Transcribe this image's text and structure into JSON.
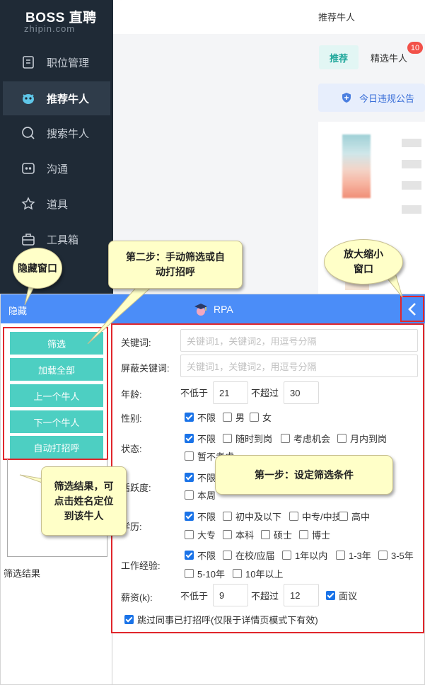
{
  "sidebar": {
    "logo": "BOSS 直聘",
    "logo_sub": "zhipin.com",
    "items": [
      {
        "label": "职位管理",
        "icon": "document-icon"
      },
      {
        "label": "推荐牛人",
        "icon": "mascot-icon"
      },
      {
        "label": "搜索牛人",
        "icon": "search-icon"
      },
      {
        "label": "沟通",
        "icon": "chat-icon"
      },
      {
        "label": "道具",
        "icon": "star-icon"
      },
      {
        "label": "工具箱",
        "icon": "briefcase-icon"
      }
    ]
  },
  "main": {
    "title": "推荐牛人",
    "tab_recommend": "推荐",
    "tab_selected": "精选牛人",
    "badge_count": "10",
    "notice": "今日违规公告"
  },
  "panel": {
    "hide": "隐藏",
    "title": "RPA",
    "toggle_icon": "chevron-left-icon",
    "buttons": {
      "filter": "筛选",
      "load_all": "加载全部",
      "prev": "上一个牛人",
      "next": "下一个牛人",
      "auto_greet": "自动打招呼"
    },
    "result_label": "筛选结果"
  },
  "form": {
    "keywords_label": "关键词:",
    "keywords_placeholder": "关键词1，关键词2，用逗号分隔",
    "block_label": "屏蔽关键词:",
    "block_placeholder": "关键词1，关键词2，用逗号分隔",
    "age_label": "年龄:",
    "min_text": "不低于",
    "max_text": "不超过",
    "age_min": "21",
    "age_max": "30",
    "gender_label": "性别:",
    "gender": [
      {
        "label": "不限",
        "checked": true
      },
      {
        "label": "男",
        "checked": false
      },
      {
        "label": "女",
        "checked": false
      }
    ],
    "status_label": "状态:",
    "status": [
      {
        "label": "不限",
        "checked": true
      },
      {
        "label": "随时到岗",
        "checked": false
      },
      {
        "label": "考虑机会",
        "checked": false
      },
      {
        "label": "月内到岗",
        "checked": false
      },
      {
        "label": "暂不考虑",
        "checked": false
      }
    ],
    "activity_label": "活跃度:",
    "activity": [
      {
        "label": "不限",
        "checked": true
      },
      {
        "label": "本周",
        "checked": false
      }
    ],
    "edu_label": "学历:",
    "edu": [
      {
        "label": "不限",
        "checked": true
      },
      {
        "label": "初中及以下",
        "checked": false
      },
      {
        "label": "中专/中技",
        "checked": false
      },
      {
        "label": "高中",
        "checked": false
      },
      {
        "label": "大专",
        "checked": false
      },
      {
        "label": "本科",
        "checked": false
      },
      {
        "label": "硕士",
        "checked": false
      },
      {
        "label": "博士",
        "checked": false
      }
    ],
    "exp_label": "工作经验:",
    "exp": [
      {
        "label": "不限",
        "checked": true
      },
      {
        "label": "在校/应届",
        "checked": false
      },
      {
        "label": "1年以内",
        "checked": false
      },
      {
        "label": "1-3年",
        "checked": false
      },
      {
        "label": "3-5年",
        "checked": false
      },
      {
        "label": "5-10年",
        "checked": false
      },
      {
        "label": "10年以上",
        "checked": false
      }
    ],
    "salary_label": "薪资(k):",
    "salary_min": "9",
    "salary_max": "12",
    "negotiable": {
      "label": "面议",
      "checked": true
    },
    "skip": {
      "label": "跳过同事已打招呼(仅限于详情页模式下有效)",
      "checked": true
    }
  },
  "callouts": {
    "hide_window": "隐藏窗口",
    "step2": "第二步：手动筛选或自动打招呼",
    "zoom": "放大缩小窗口",
    "step1": "第一步：设定筛选条件",
    "result_tip": "筛选结果，可点击姓名定位到该牛人"
  }
}
